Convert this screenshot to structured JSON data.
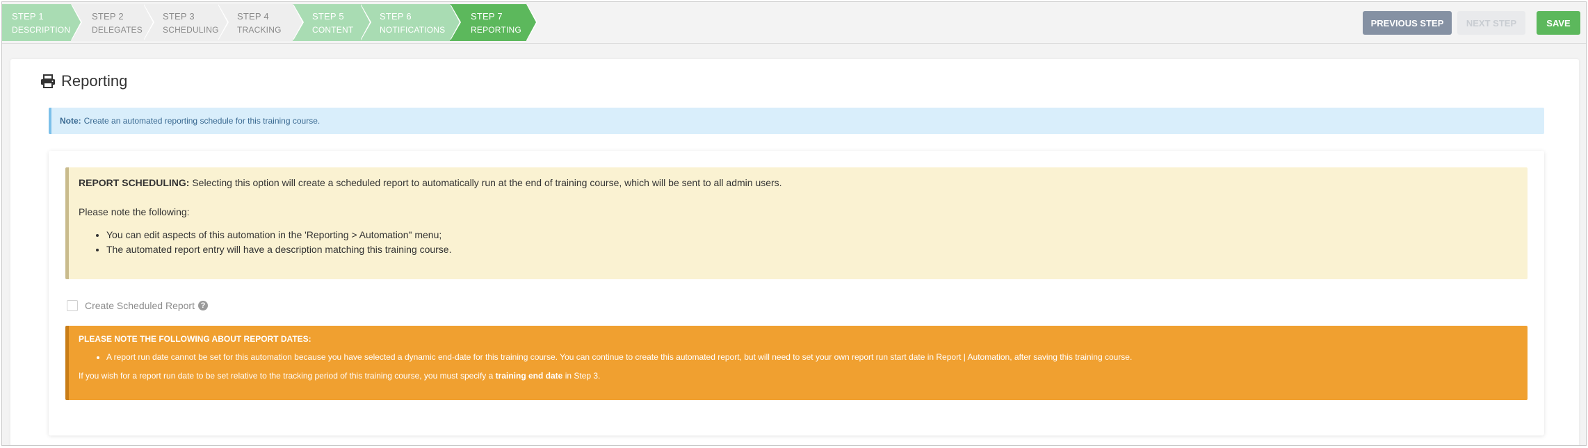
{
  "wizard": {
    "steps": [
      {
        "num": "STEP 1",
        "label": "DESCRIPTION",
        "state": "done"
      },
      {
        "num": "STEP 2",
        "label": "DELEGATES",
        "state": "pending"
      },
      {
        "num": "STEP 3",
        "label": "SCHEDULING",
        "state": "pending"
      },
      {
        "num": "STEP 4",
        "label": "TRACKING",
        "state": "pending"
      },
      {
        "num": "STEP 5",
        "label": "CONTENT",
        "state": "done"
      },
      {
        "num": "STEP 6",
        "label": "NOTIFICATIONS",
        "state": "done"
      },
      {
        "num": "STEP 7",
        "label": "REPORTING",
        "state": "active"
      }
    ],
    "previous_label": "PREVIOUS STEP",
    "next_label": "NEXT STEP",
    "save_label": "SAVE"
  },
  "page": {
    "title": "Reporting",
    "title_icon": "printer-icon"
  },
  "note": {
    "label": "Note:",
    "text": "Create an automated reporting schedule for this training course."
  },
  "scheduling": {
    "heading": "REPORT SCHEDULING:",
    "text": "Selecting this option will create a scheduled report to automatically run at the end of training course, which will be sent to all admin users.",
    "follow": "Please note the following:",
    "items": [
      "You can edit aspects of this automation in the 'Reporting > Automation\" menu;",
      "The automated report entry will have a description matching this training course."
    ]
  },
  "checkbox": {
    "label": "Create Scheduled Report",
    "checked": false
  },
  "dates_warning": {
    "heading": "PLEASE NOTE THE FOLLOWING ABOUT REPORT DATES:",
    "item": "A report run date cannot be set for this automation because you have selected a dynamic end-date for this training course. You can continue to create this automated report, but will need to set your own report run start date in Report | Automation, after saving this training course.",
    "footer_pre": "If you wish for a report run date to be set relative to the tracking period of this training course, you must specify a",
    "footer_bold": "training end date",
    "footer_post": "in Step 3."
  },
  "colors": {
    "step_done": "#a9dcb3",
    "step_active": "#5cb85c",
    "step_pending": "#eeeeee",
    "note_bg": "#d9eefb",
    "warn_bg": "#faf2d2",
    "orange": "#f0a030"
  }
}
